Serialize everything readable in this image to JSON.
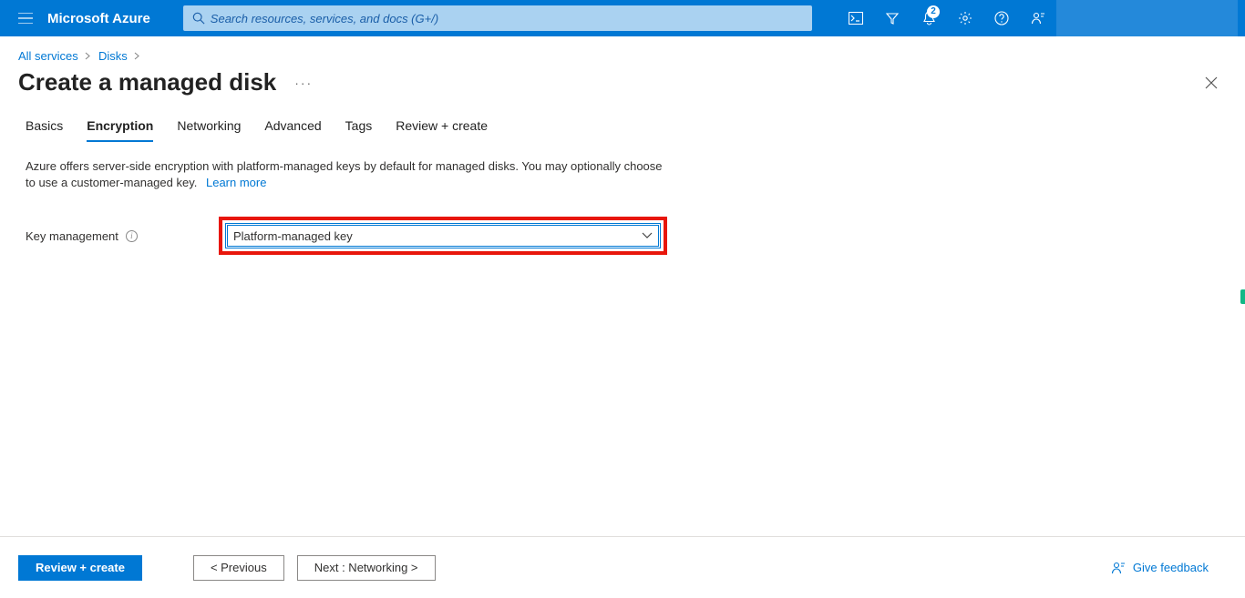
{
  "header": {
    "brand": "Microsoft Azure",
    "search_placeholder": "Search resources, services, and docs (G+/)",
    "notification_count": "2"
  },
  "breadcrumb": {
    "items": [
      "All services",
      "Disks"
    ]
  },
  "page": {
    "title": "Create a managed disk"
  },
  "tabs": [
    {
      "id": "basics",
      "label": "Basics"
    },
    {
      "id": "encryption",
      "label": "Encryption"
    },
    {
      "id": "networking",
      "label": "Networking"
    },
    {
      "id": "advanced",
      "label": "Advanced"
    },
    {
      "id": "tags",
      "label": "Tags"
    },
    {
      "id": "review",
      "label": "Review + create"
    }
  ],
  "content": {
    "description": "Azure offers server-side encryption with platform-managed keys by default for managed disks. You may optionally choose to use a customer-managed key.",
    "learn_more": "Learn more",
    "key_management_label": "Key management",
    "key_management_value": "Platform-managed key"
  },
  "footer": {
    "review_create": "Review + create",
    "previous": "< Previous",
    "next": "Next : Networking >",
    "feedback": "Give feedback"
  }
}
